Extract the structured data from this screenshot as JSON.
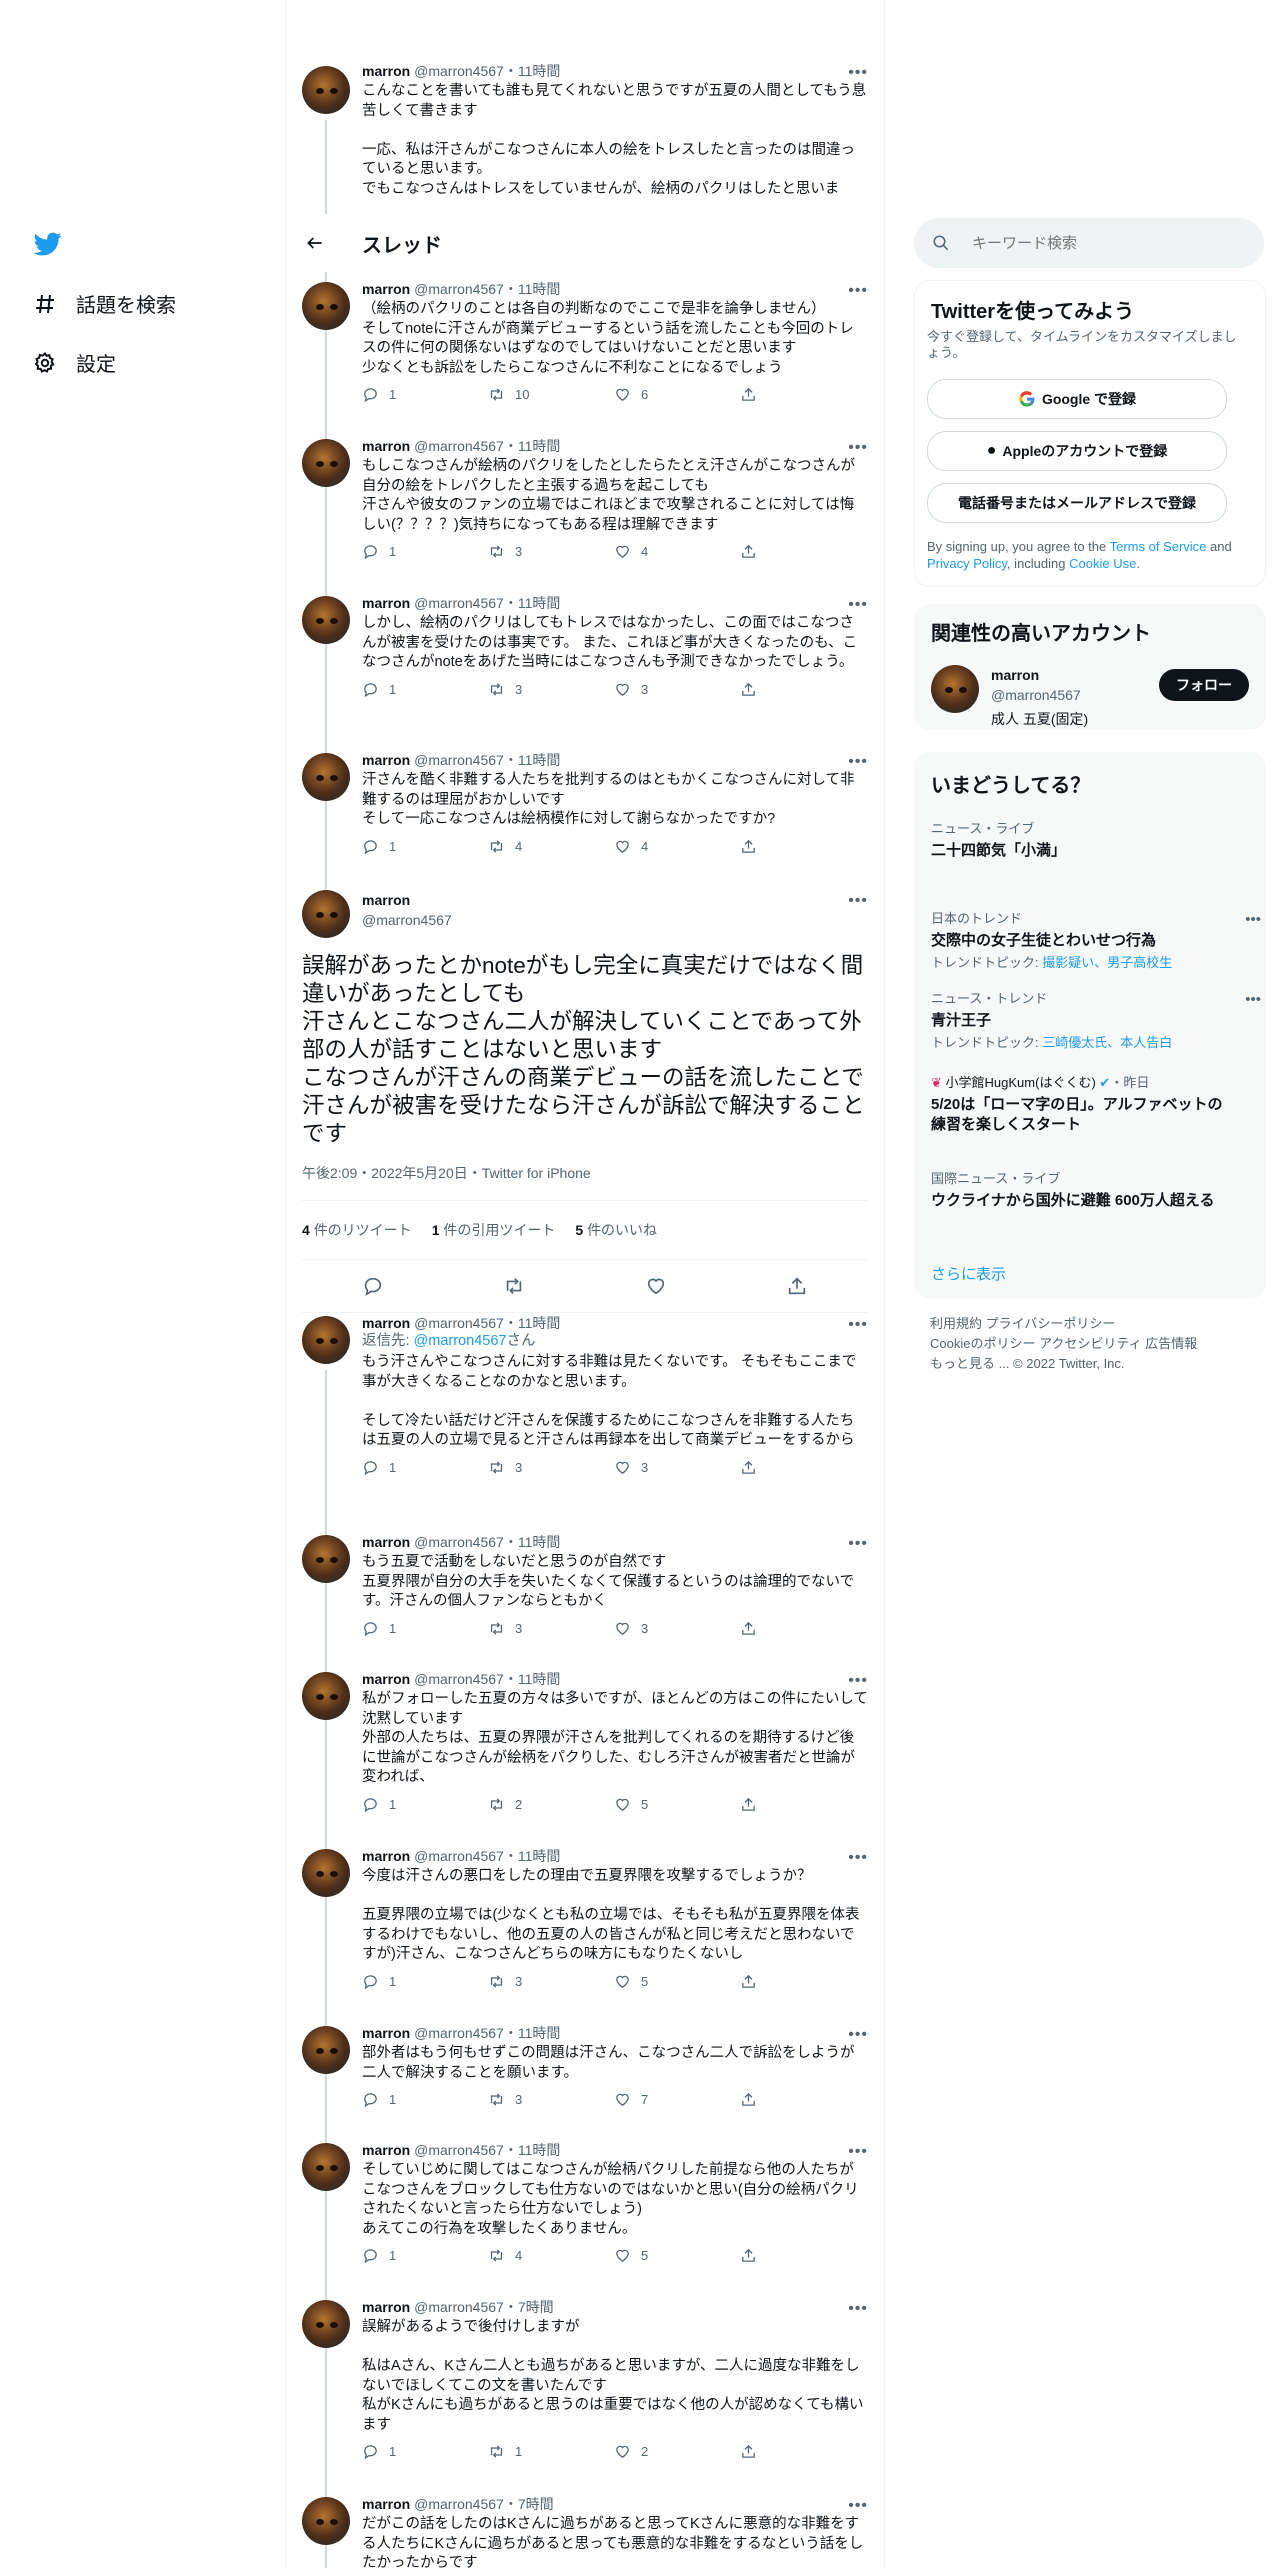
{
  "nav": {
    "explore": "話題を検索",
    "settings": "設定"
  },
  "header": {
    "title": "スレッド"
  },
  "author": {
    "name": "marron",
    "handle": "@marron4567"
  },
  "tweets_above": [
    {
      "time": "11時間",
      "text": "こんなことを書いても誰も見てくれないと思うですが五夏の人間としてもう息苦しくて書きます\n\n一応、私は汗さんがこなつさんに本人の絵をトレスしたと言ったのは間違っていると思います。\nでもこなつさんはトレスをしていませんが、絵柄のパクリはしたと思いま",
      "replies": "",
      "retweets": "",
      "likes": ""
    },
    {
      "time": "11時間",
      "text": "（絵柄のパクリのことは各自の判断なのでここで是非を論争しません）\nそしてnoteに汗さんが商業デビューするという話を流したことも今回のトレスの件に何の関係ないはずなのでしてはいけないことだと思います\n少なくとも訴訟をしたらこなつさんに不利なことになるでしょう",
      "replies": "1",
      "retweets": "10",
      "likes": "6"
    },
    {
      "time": "11時間",
      "text": "もしこなつさんが絵柄のパクリをしたとしたらたとえ汗さんがこなつさんが自分の絵をトレパクしたと主張する過ちを起こしても\n汗さんや彼女のファンの立場ではこれほどまで攻撃されることに対しては悔しい(？？？？)気持ちになってもある程は理解できます",
      "replies": "1",
      "retweets": "3",
      "likes": "4"
    },
    {
      "time": "11時間",
      "text": "しかし、絵柄のパクリはしてもトレスではなかったし、この面ではこなつさんが被害を受けたのは事実です。 また、これほど事が大きくなったのも、こなつさんがnoteをあげた当時にはこなつさんも予測できなかったでしょう。",
      "replies": "1",
      "retweets": "3",
      "likes": "3"
    },
    {
      "time": "11時間",
      "text": "汗さんを酷く非難する人たちを批判するのはともかくこなつさんに対して非難するのは理屈がおかしいです\nそして一応こなつさんは絵柄模作に対して謝らなかったですか?",
      "replies": "1",
      "retweets": "4",
      "likes": "4"
    }
  ],
  "focus": {
    "text": "誤解があったとかnoteがもし完全に真実だけではなく間違いがあったとしても\n汗さんとこなつさん二人が解決していくことであって外部の人が話すことはないと思います\nこなつさんが汗さんの商業デビューの話を流したことで汗さんが被害を受けたなら汗さんが訴訟で解決することです",
    "meta": "午後2:09・2022年5月20日・Twitter for iPhone",
    "retweets_num": "4",
    "retweets_label": "件のリツイート",
    "quotes_num": "1",
    "quotes_label": "件の引用ツイート",
    "likes_num": "5",
    "likes_label": "件のいいね"
  },
  "replies": [
    {
      "time": "11時間",
      "reply_prefix": "返信先: ",
      "reply_handle": "@marron4567",
      "reply_suffix": "さん",
      "text": "もう汗さんやこなつさんに対する非難は見たくないです。 そもそもここまで事が大きくなることなのかなと思います。\n\nそして冷たい話だけど汗さんを保護するためにこなつさんを非難する人たちは五夏の人の立場で見ると汗さんは再録本を出して商業デビューをするから",
      "replies": "1",
      "retweets": "3",
      "likes": "3"
    },
    {
      "time": "11時間",
      "text": "もう五夏で活動をしないだと思うのが自然です\n五夏界隈が自分の大手を失いたくなくて保護するというのは論理的でないです。汗さんの個人ファンならともかく",
      "replies": "1",
      "retweets": "3",
      "likes": "3"
    },
    {
      "time": "11時間",
      "text": "私がフォローした五夏の方々は多いですが、ほとんどの方はこの件にたいして沈黙しています\n外部の人たちは、五夏の界隈が汗さんを批判してくれるのを期待するけど後に世論がこなつさんが絵柄をパクりした、むしろ汗さんが被害者だと世論が変われば、",
      "replies": "1",
      "retweets": "2",
      "likes": "5"
    },
    {
      "time": "11時間",
      "text": "今度は汗さんの悪口をしたの理由で五夏界隈を攻撃するでしょうか？\n\n五夏界隈の立場では(少なくとも私の立場では、そもそも私が五夏界隈を体表するわけでもないし、他の五夏の人の皆さんが私と同じ考えだと思わないですが)汗さん、こなつさんどちらの味方にもなりたくないし",
      "replies": "1",
      "retweets": "3",
      "likes": "5"
    },
    {
      "time": "11時間",
      "text": "部外者はもう何もせずこの問題は汗さん、こなつさん二人で訴訟をしようが二人で解決することを願います。",
      "replies": "1",
      "retweets": "3",
      "likes": "7"
    },
    {
      "time": "11時間",
      "text": "そしていじめに関してはこなつさんが絵柄パクリした前提なら他の人たちがこなつさんをブロックしても仕方ないのではないかと思い(自分の絵柄パクリされたくないと言ったら仕方ないでしょう)\nあえてこの行為を攻撃したくありません。",
      "replies": "1",
      "retweets": "4",
      "likes": "5"
    },
    {
      "time": "7時間",
      "text": "誤解があるようで後付けしますが\n\n私はAさん、Kさん二人とも過ちがあると思いますが、二人に過度な非難をしないでほしくてこの文を書いたんです\n私がKさんにも過ちがあると思うのは重要ではなく他の人が認めなくても構います",
      "replies": "1",
      "retweets": "1",
      "likes": "2"
    },
    {
      "time": "7時間",
      "text": "だがこの話をしたのはKさんに過ちがあると思ってKさんに悪意的な非難をする人たちにKさんに過ちがあると思っても悪意的な非難をするなという話をしたかったからです",
      "replies": "",
      "retweets": "",
      "likes": ""
    }
  ],
  "search": {
    "placeholder": "キーワード検索"
  },
  "signup": {
    "title": "Twitterを使ってみよう",
    "subtitle": "今すぐ登録して、タイムラインをカスタマイズしましょう。",
    "google": "Google で登録",
    "apple": "Appleのアカウントで登録",
    "phone": "電話番号またはメールアドレスで登録",
    "terms_prefix": "By signing up, you agree to the ",
    "terms_link": "Terms of Service",
    "terms_and": " and ",
    "privacy_link": "Privacy Policy",
    "terms_including": ", including ",
    "cookie_link": "Cookie Use",
    "terms_end": "."
  },
  "related": {
    "title": "関連性の高いアカウント",
    "name": "marron",
    "handle": "@marron4567",
    "bio": "成人 五夏(固定)",
    "follow": "フォロー"
  },
  "trends": {
    "title": "いまどうしてる？",
    "items": [
      {
        "category": "ニュース・ライブ",
        "title": "二十四節気「小満」",
        "sub": "",
        "links": ""
      },
      {
        "category": "日本のトレンド",
        "title": "交際中の女子生徒とわいせつ行為",
        "sub": "トレンドトピック: ",
        "links": "撮影疑い、男子高校生"
      },
      {
        "category": "ニュース・トレンド",
        "title": "青汁王子",
        "sub": "トレンドトピック: ",
        "links": "三崎優太氏、本人告白"
      },
      {
        "category": "小学館HugKum(はぐくむ)",
        "category_suffix": "・昨日",
        "title": "5/20は「ローマ字の日」。アルファベットの練習を楽しくスタート",
        "sub": "",
        "links": ""
      },
      {
        "category": "国際ニュース・ライブ",
        "title": "ウクライナから国外に避難 600万人超える",
        "sub": "",
        "links": ""
      }
    ],
    "more": "さらに表示"
  },
  "footer": {
    "line1": "利用規約  プライバシーポリシー",
    "line2": "Cookieのポリシー  アクセシビリティ  広告情報",
    "line3": "もっと見る ...   © 2022 Twitter, Inc."
  }
}
